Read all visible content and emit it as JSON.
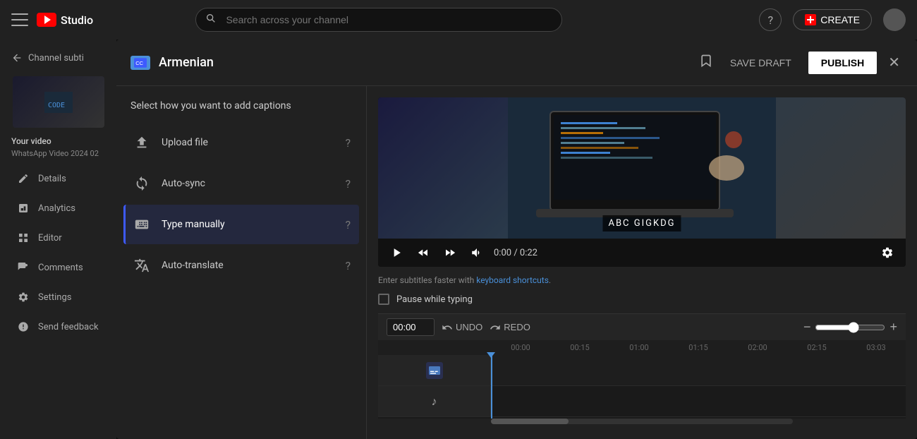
{
  "topbar": {
    "menu_label": "Menu",
    "logo_text": "Studio",
    "search_placeholder": "Search across your channel",
    "help_icon": "?",
    "create_label": "CREATE",
    "avatar_label": "User Avatar"
  },
  "sidebar": {
    "back_label": "Channel subti",
    "video_label": "Your video",
    "video_filename": "WhatsApp Video 2024 02",
    "nav_items": [
      {
        "id": "details",
        "label": "Details",
        "icon": "pencil"
      },
      {
        "id": "analytics",
        "label": "Analytics",
        "icon": "chart"
      },
      {
        "id": "editor",
        "label": "Editor",
        "icon": "grid"
      },
      {
        "id": "comments",
        "label": "Comments",
        "icon": "comment"
      },
      {
        "id": "settings",
        "label": "Settings",
        "icon": "gear"
      },
      {
        "id": "feedback",
        "label": "Send feedback",
        "icon": "flag"
      }
    ]
  },
  "modal": {
    "lang_label": "Armenian",
    "save_draft": "SAVE DRAFT",
    "publish": "PUBLISH",
    "close_label": "Close",
    "captions_title": "Select how you want to add captions",
    "caption_options": [
      {
        "id": "upload",
        "label": "Upload file",
        "icon": "upload"
      },
      {
        "id": "autosync",
        "label": "Auto-sync",
        "icon": "sync"
      },
      {
        "id": "manual",
        "label": "Type manually",
        "icon": "keyboard",
        "selected": true
      },
      {
        "id": "autotranslate",
        "label": "Auto-translate",
        "icon": "translate"
      }
    ],
    "video": {
      "caption_text": "ABC GIGKDG",
      "time_current": "0:00",
      "time_total": "0:22"
    },
    "subtitle_hint": "Enter subtitles faster with",
    "keyboard_shortcuts": "keyboard shortcuts",
    "pause_while_typing": "Pause while typing"
  },
  "timeline": {
    "time_input": "00:00",
    "undo_label": "UNDO",
    "redo_label": "REDO",
    "ruler_marks": [
      "00:00",
      "00:15",
      "01:00",
      "01:15",
      "02:00",
      "02:15",
      "03:03"
    ]
  }
}
